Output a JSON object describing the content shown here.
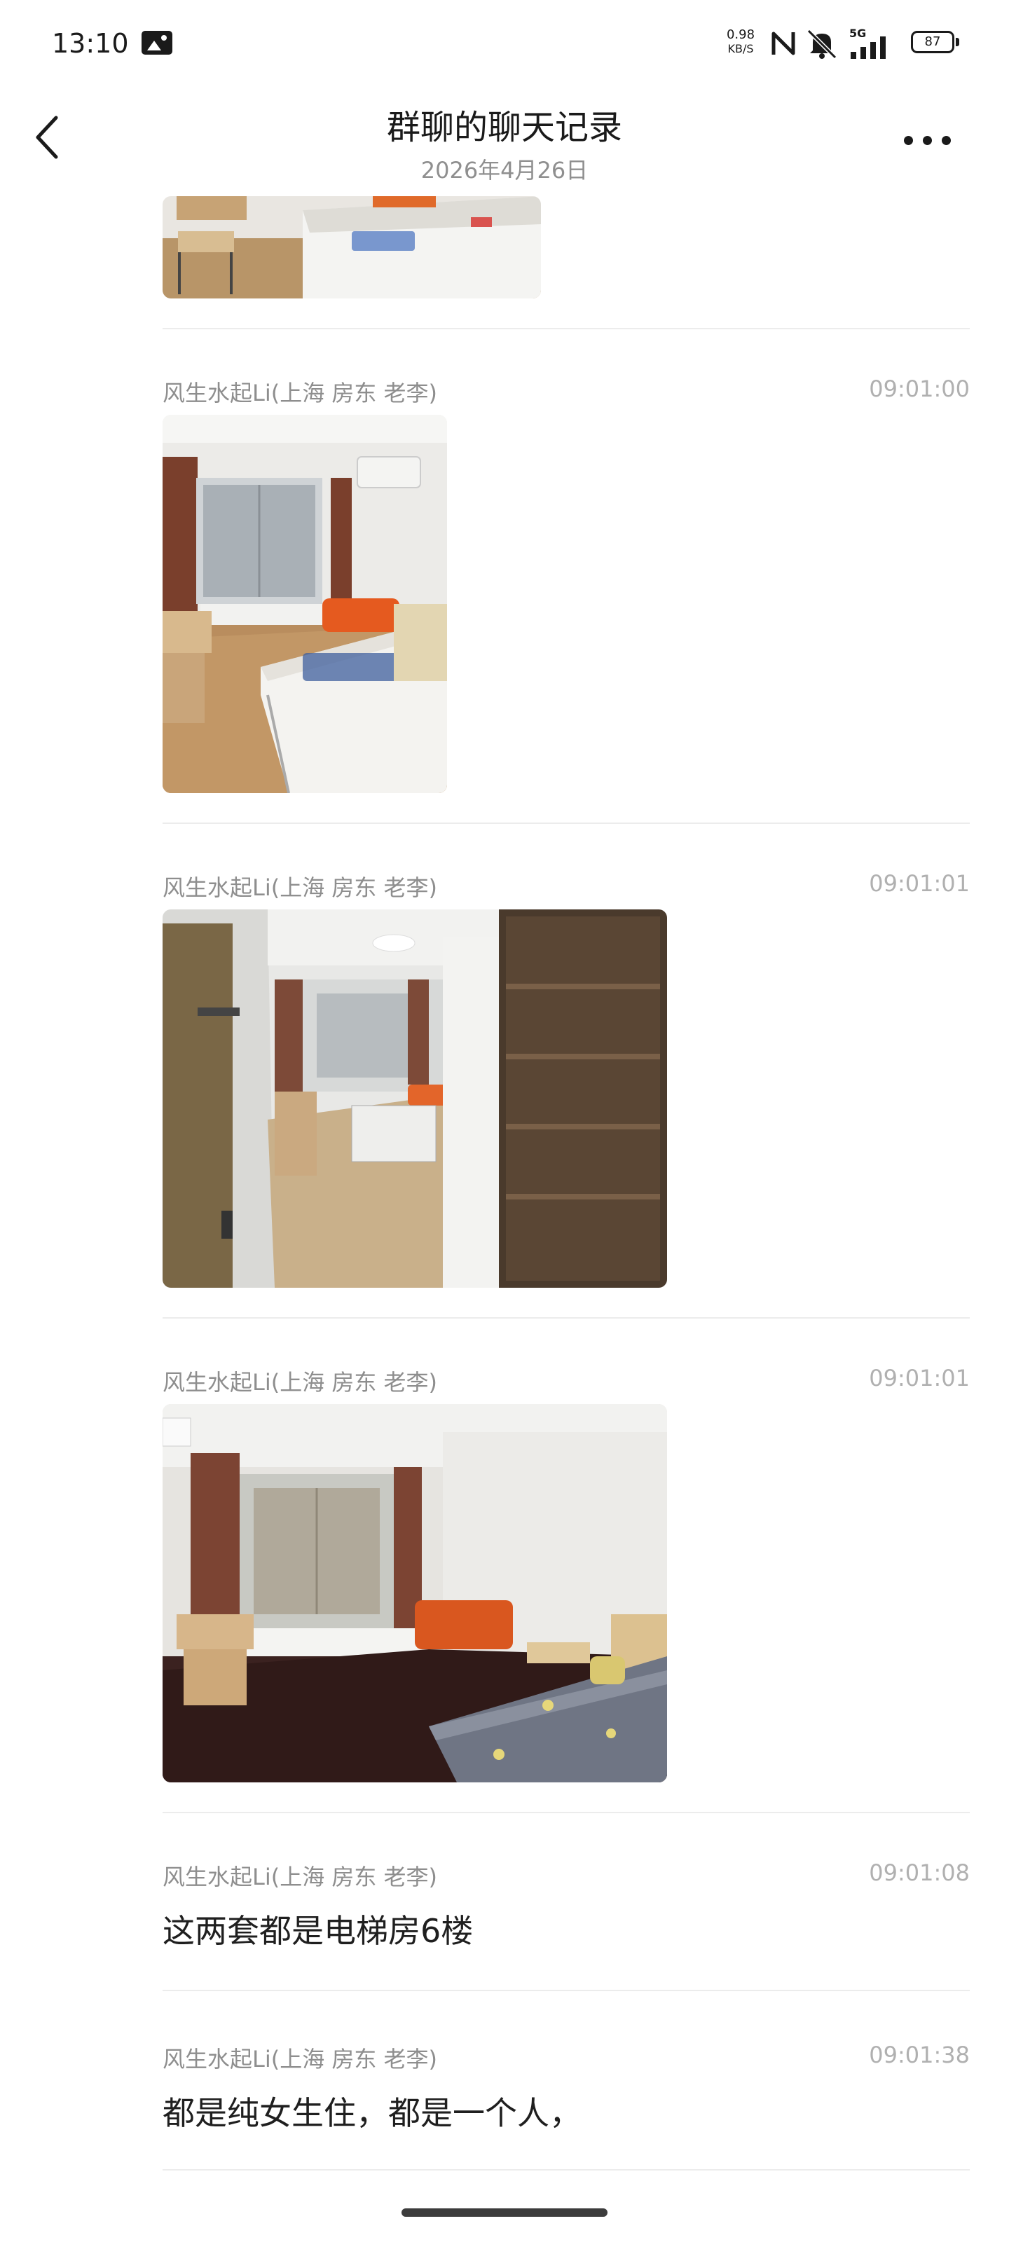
{
  "status_bar": {
    "time": "13:10",
    "speed_value": "0.98",
    "speed_unit": "KB/S",
    "network": "5G",
    "battery": "87"
  },
  "header": {
    "title": "群聊的聊天记录",
    "date": "2026年4月26日"
  },
  "messages": [
    {
      "type": "image",
      "alt_desc": "bedroom photo (partial)"
    },
    {
      "type": "image",
      "sender": "风生水起Li(上海 房东 老李)",
      "time": "09:01:00"
    },
    {
      "type": "image",
      "sender": "风生水起Li(上海 房东 老李)",
      "time": "09:01:01"
    },
    {
      "type": "image",
      "sender": "风生水起Li(上海 房东 老李)",
      "time": "09:01:01"
    },
    {
      "type": "text",
      "sender": "风生水起Li(上海 房东 老李)",
      "time": "09:01:08",
      "text": "这两套都是电梯房6楼"
    },
    {
      "type": "text",
      "sender": "风生水起Li(上海 房东 老李)",
      "time": "09:01:38",
      "text": "都是纯女生住，都是一个人，"
    }
  ],
  "colors": {
    "sender": "#8e8e8e",
    "time": "#b0b0b0",
    "divider": "#ececec",
    "text": "#1f1f1f"
  }
}
